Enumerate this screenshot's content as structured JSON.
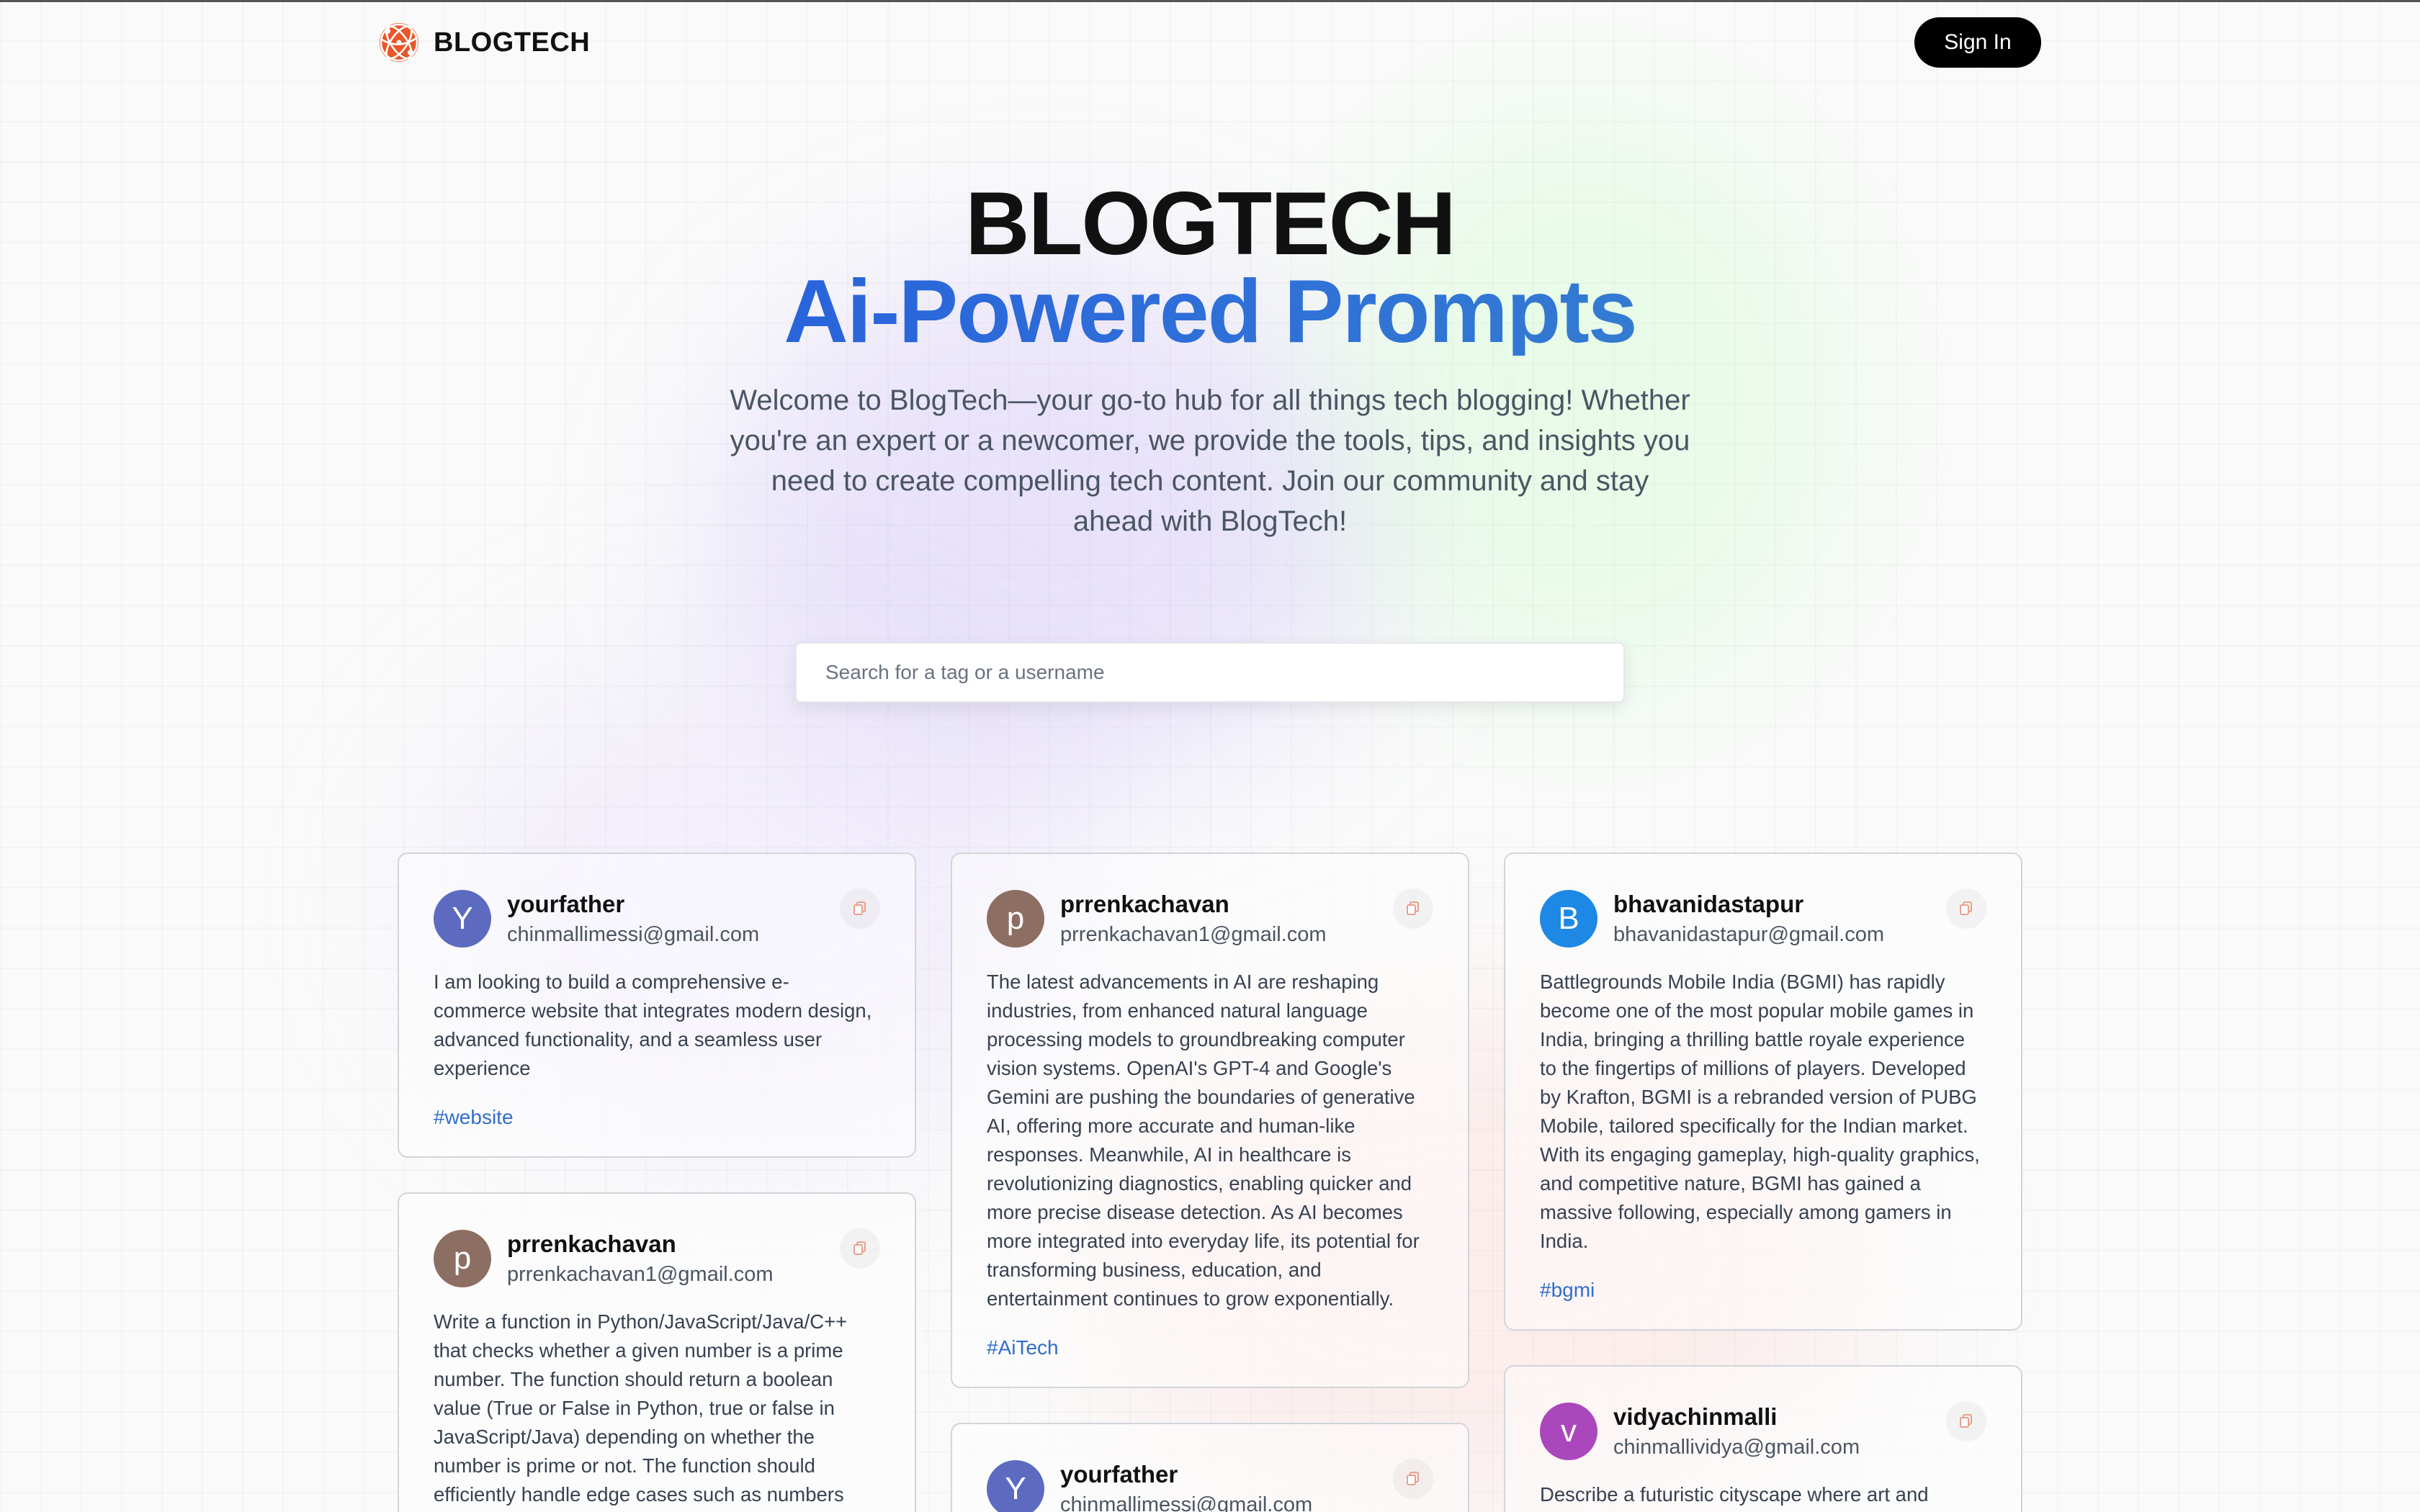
{
  "brand": {
    "name": "BLOGTECH"
  },
  "nav": {
    "sign_in_label": "Sign In"
  },
  "hero": {
    "title": "BLOGTECH",
    "subtitle": "Ai-Powered Prompts",
    "description": "Welcome to BlogTech—your go-to hub for all things tech blogging! Whether you're an expert or a newcomer, we provide the tools, tips, and insights you need to create compelling tech content. Join our community and stay ahead with BlogTech!"
  },
  "search": {
    "placeholder": "Search for a tag or a username",
    "value": ""
  },
  "colors": {
    "accent_gradient": [
      "#1d4fe0",
      "#3b90c4"
    ],
    "tag": "#2f6fc9",
    "logo": "#e8572a",
    "sign_in_bg": "#000000"
  },
  "feed": {
    "columns": [
      {
        "posts": [
          {
            "avatar_letter": "Y",
            "avatar_color": "#5c6bc0",
            "username": "yourfather",
            "email": "chinmallimessi@gmail.com",
            "text": "I am looking to build a comprehensive e-commerce website that integrates modern design, advanced functionality, and a seamless user experience",
            "tag": "#website"
          },
          {
            "avatar_letter": "p",
            "avatar_color": "#8d6e63",
            "username": "prrenkachavan",
            "email": "prrenkachavan1@gmail.com",
            "text": "Write a function in Python/JavaScript/Java/C++ that checks whether a given number is a prime number. The function should return a boolean value (True or False in Python, true or false in JavaScript/Java) depending on whether the number is prime or not. The function should efficiently handle edge cases such as numbers",
            "tag": ""
          }
        ]
      },
      {
        "posts": [
          {
            "avatar_letter": "p",
            "avatar_color": "#8d6e63",
            "username": "prrenkachavan",
            "email": "prrenkachavan1@gmail.com",
            "text": "The latest advancements in AI are reshaping industries, from enhanced natural language processing models to groundbreaking computer vision systems. OpenAI's GPT-4 and Google's Gemini are pushing the boundaries of generative AI, offering more accurate and human-like responses. Meanwhile, AI in healthcare is revolutionizing diagnostics, enabling quicker and more precise disease detection. As AI becomes more integrated into everyday life, its potential for transforming business, education, and entertainment continues to grow exponentially.",
            "tag": "#AiTech"
          },
          {
            "avatar_letter": "Y",
            "avatar_color": "#5c6bc0",
            "username": "yourfather",
            "email": "chinmallimessi@gmail.com",
            "text": "",
            "tag": ""
          }
        ]
      },
      {
        "posts": [
          {
            "avatar_letter": "B",
            "avatar_color": "#1e88e5",
            "username": "bhavanidastapur",
            "email": "bhavanidastapur@gmail.com",
            "text": "Battlegrounds Mobile India (BGMI) has rapidly become one of the most popular mobile games in India, bringing a thrilling battle royale experience to the fingertips of millions of players. Developed by Krafton, BGMI is a rebranded version of PUBG Mobile, tailored specifically for the Indian market. With its engaging gameplay, high-quality graphics, and competitive nature, BGMI has gained a massive following, especially among gamers in India.",
            "tag": "#bgmi"
          },
          {
            "avatar_letter": "v",
            "avatar_color": "#ab47bc",
            "username": "vidyachinmalli",
            "email": "chinmallividya@gmail.com",
            "text": "Describe a futuristic cityscape where art and",
            "tag": ""
          }
        ]
      }
    ]
  }
}
